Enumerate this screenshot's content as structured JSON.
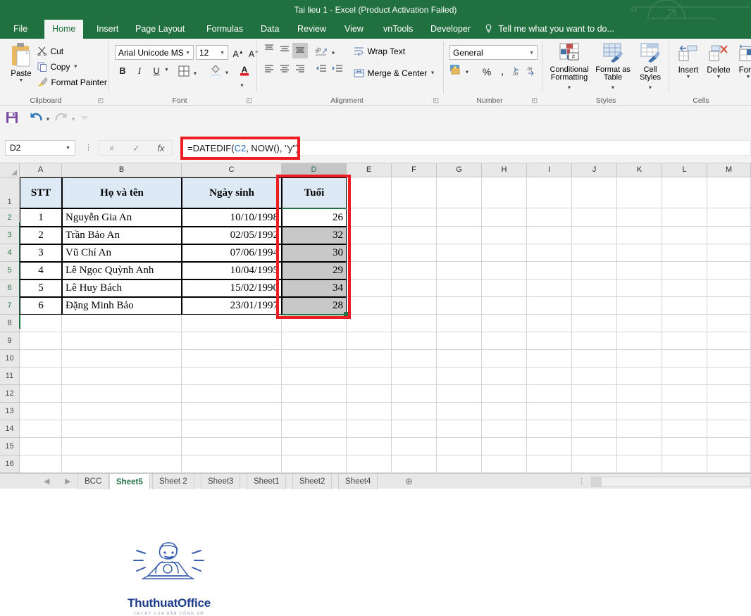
{
  "window": {
    "title": "Tai lieu 1 - Excel (Product Activation Failed)"
  },
  "ribbon": {
    "tabs": [
      {
        "label": "File",
        "active": false
      },
      {
        "label": "Home",
        "active": true
      },
      {
        "label": "Insert",
        "active": false
      },
      {
        "label": "Page Layout",
        "active": false
      },
      {
        "label": "Formulas",
        "active": false
      },
      {
        "label": "Data",
        "active": false
      },
      {
        "label": "Review",
        "active": false
      },
      {
        "label": "View",
        "active": false
      },
      {
        "label": "vnTools",
        "active": false
      },
      {
        "label": "Developer",
        "active": false
      }
    ],
    "tellme": "Tell me what you want to do...",
    "groups": {
      "clipboard": {
        "label": "Clipboard",
        "paste": "Paste",
        "cut": "Cut",
        "copy": "Copy",
        "format_painter": "Format Painter"
      },
      "font": {
        "label": "Font",
        "font_name": "Arial Unicode MS",
        "font_size": "12",
        "bold": "B",
        "italic": "I",
        "underline": "U"
      },
      "alignment": {
        "label": "Alignment",
        "wrap_text": "Wrap Text",
        "merge_center": "Merge & Center"
      },
      "number": {
        "label": "Number",
        "format": "General",
        "percent": "%",
        "comma": ","
      },
      "styles": {
        "label": "Styles",
        "conditional_formatting": "Conditional Formatting",
        "format_as_table": "Format as Table",
        "cell_styles": "Cell Styles"
      },
      "cells": {
        "label": "Cells",
        "insert": "Insert",
        "delete": "Delete",
        "format": "Form"
      }
    }
  },
  "quick_access": {
    "save": "save-icon",
    "undo": "undo-icon",
    "redo": "redo-icon"
  },
  "formula_bar": {
    "name_box": "D2",
    "cancel": "×",
    "enter": "✓",
    "insert_function": "fx",
    "formula_prefix": "=DATEDIF(",
    "formula_ref": "C2",
    "formula_suffix": ", NOW(), \"y\")"
  },
  "grid": {
    "columns": [
      "A",
      "B",
      "C",
      "D",
      "E",
      "F",
      "G",
      "H",
      "I",
      "J",
      "K",
      "L",
      "M"
    ],
    "selected_column": "D",
    "rows": [
      "1",
      "2",
      "3",
      "4",
      "5",
      "6",
      "7",
      "8",
      "9",
      "10",
      "11",
      "12",
      "13",
      "14",
      "15",
      "16"
    ],
    "selected_rows": [
      "2",
      "3",
      "4",
      "5",
      "6",
      "7"
    ],
    "headers": [
      "STT",
      "Họ và tên",
      "Ngày sinh",
      "Tuổi"
    ],
    "data": [
      {
        "stt": "1",
        "name": "Nguyễn Gia An",
        "dob": "10/10/1998",
        "age": "26"
      },
      {
        "stt": "2",
        "name": "Trần Bảo An",
        "dob": "02/05/1992",
        "age": "32"
      },
      {
        "stt": "3",
        "name": "Vũ Chí An",
        "dob": "07/06/1994",
        "age": "30"
      },
      {
        "stt": "4",
        "name": "Lê Ngọc Quỳnh Anh",
        "dob": "10/04/1995",
        "age": "29"
      },
      {
        "stt": "5",
        "name": "Lê Huy Bách",
        "dob": "15/02/1990",
        "age": "34"
      },
      {
        "stt": "6",
        "name": "Đặng Minh Bảo",
        "dob": "23/01/1997",
        "age": "28"
      }
    ]
  },
  "watermark": {
    "title": "ThuthuatOffice",
    "tagline": "TRI KỶ CỦA DÂN CÔNG SỞ"
  },
  "sheet_tabs": {
    "items": [
      {
        "label": "BCC",
        "active": false
      },
      {
        "label": "Sheet5",
        "active": true
      },
      {
        "label": "Sheet 2",
        "active": false
      },
      {
        "label": "Sheet3",
        "active": false
      },
      {
        "label": "Sheet1",
        "active": false
      },
      {
        "label": "Sheet2",
        "active": false
      },
      {
        "label": "Sheet4",
        "active": false
      }
    ],
    "add": "⊕"
  },
  "colors": {
    "excel_green": "#21703f",
    "annotation_red": "#ee1d23",
    "header_fill": "#ddeaf6"
  }
}
